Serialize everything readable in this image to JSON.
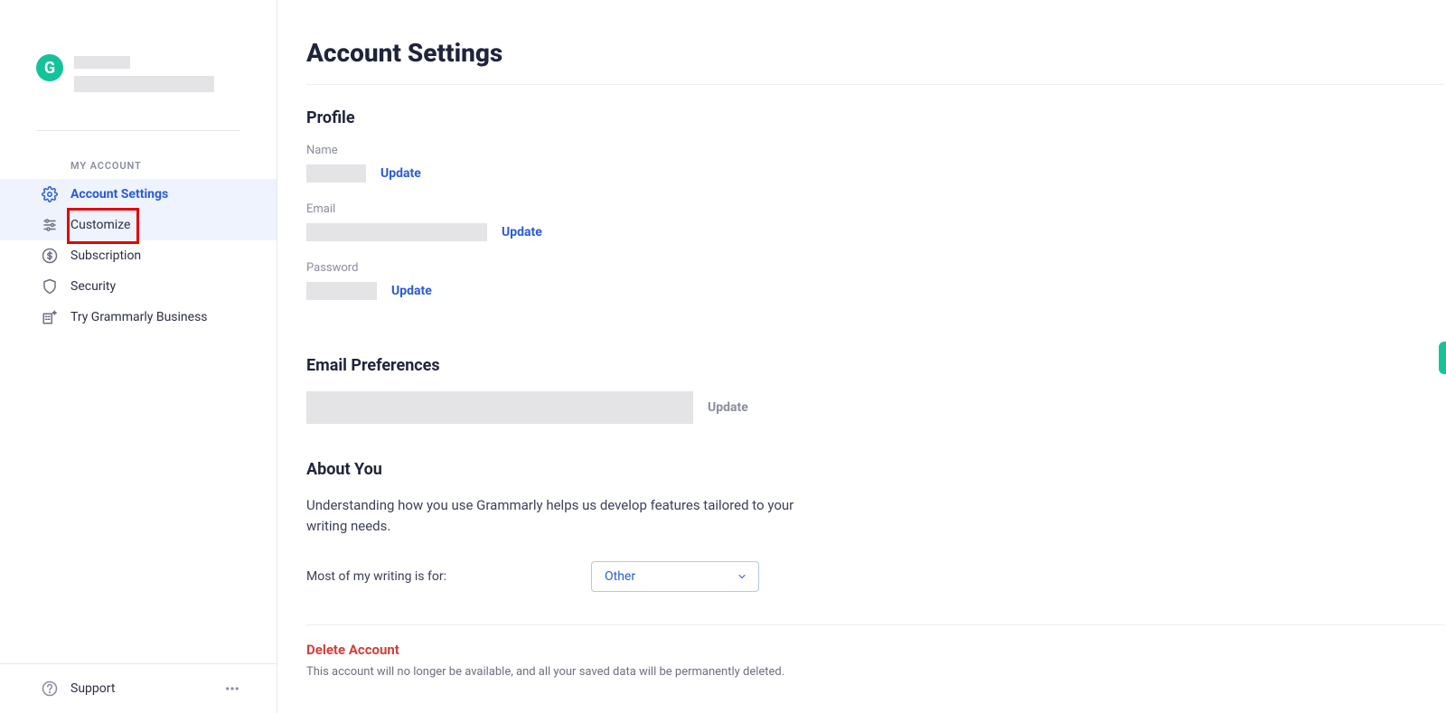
{
  "brand": {
    "letter": "G"
  },
  "sidebar": {
    "section_label": "MY ACCOUNT",
    "items": [
      {
        "label": "Account Settings",
        "icon": "gear-icon",
        "active": true,
        "hover": false
      },
      {
        "label": "Customize",
        "icon": "sliders-icon",
        "active": false,
        "hover": true,
        "annotated": true
      },
      {
        "label": "Subscription",
        "icon": "dollar-circle-icon",
        "active": false,
        "hover": false
      },
      {
        "label": "Security",
        "icon": "shield-icon",
        "active": false,
        "hover": false
      },
      {
        "label": "Try Grammarly Business",
        "icon": "building-spark-icon",
        "active": false,
        "hover": false
      }
    ],
    "footer": {
      "label": "Support",
      "icon": "help-circle-icon",
      "more_icon": "more-horizontal-icon"
    }
  },
  "page": {
    "title": "Account Settings",
    "profile": {
      "heading": "Profile",
      "name_label": "Name",
      "name_update": "Update",
      "email_label": "Email",
      "email_update": "Update",
      "password_label": "Password",
      "password_update": "Update"
    },
    "email_prefs": {
      "heading": "Email Preferences",
      "update": "Update"
    },
    "about": {
      "heading": "About You",
      "description": "Understanding how you use Grammarly helps us develop features tailored to your writing needs.",
      "prompt": "Most of my writing is for:",
      "selected": "Other"
    },
    "danger": {
      "heading": "Delete Account",
      "text": "This account will no longer be available, and all your saved data will be permanently deleted."
    }
  }
}
